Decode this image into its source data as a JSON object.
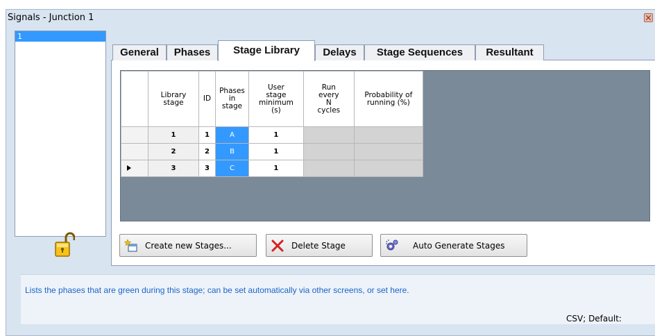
{
  "window": {
    "title": "Signals - Junction 1"
  },
  "junction_list": {
    "items": [
      "1"
    ]
  },
  "tabs": [
    {
      "label": "General",
      "active": false
    },
    {
      "label": "Phases",
      "active": false
    },
    {
      "label": "Stage Library",
      "active": true
    },
    {
      "label": "Delays",
      "active": false
    },
    {
      "label": "Stage Sequences",
      "active": false
    },
    {
      "label": "Resultant",
      "active": false
    }
  ],
  "grid": {
    "headers": {
      "library_stage": "Library stage",
      "id": "ID",
      "phases_in_stage": "Phases in stage",
      "user_stage_min": "User stage minimum (s)",
      "run_every_n": "Run every N cycles",
      "probability": "Probability of running (%)"
    },
    "rows": [
      {
        "current": false,
        "library_stage": "1",
        "id": "1",
        "phases": "A",
        "user_min": "1",
        "run_every_n": "",
        "probability": ""
      },
      {
        "current": false,
        "library_stage": "2",
        "id": "2",
        "phases": "B",
        "user_min": "1",
        "run_every_n": "",
        "probability": ""
      },
      {
        "current": true,
        "library_stage": "3",
        "id": "3",
        "phases": "C",
        "user_min": "1",
        "run_every_n": "",
        "probability": ""
      }
    ]
  },
  "buttons": {
    "create": "Create new Stages...",
    "delete": "Delete Stage",
    "auto": "Auto Generate Stages"
  },
  "icons": {
    "lock": "unlocked-padlock-icon",
    "create": "new-stage-icon",
    "delete": "red-x-icon",
    "auto": "auto-generate-icon",
    "current_row": "row-pointer-icon"
  },
  "hint": {
    "text": "Lists the phases that are green during this stage;  can be set automatically via other screens, or set here.",
    "csv_default": "CSV; Default:"
  },
  "colors": {
    "selection": "#3399ff",
    "hint_text": "#1a64c8",
    "grid_background": "#7b8a98",
    "delete_icon": "#d42020"
  }
}
